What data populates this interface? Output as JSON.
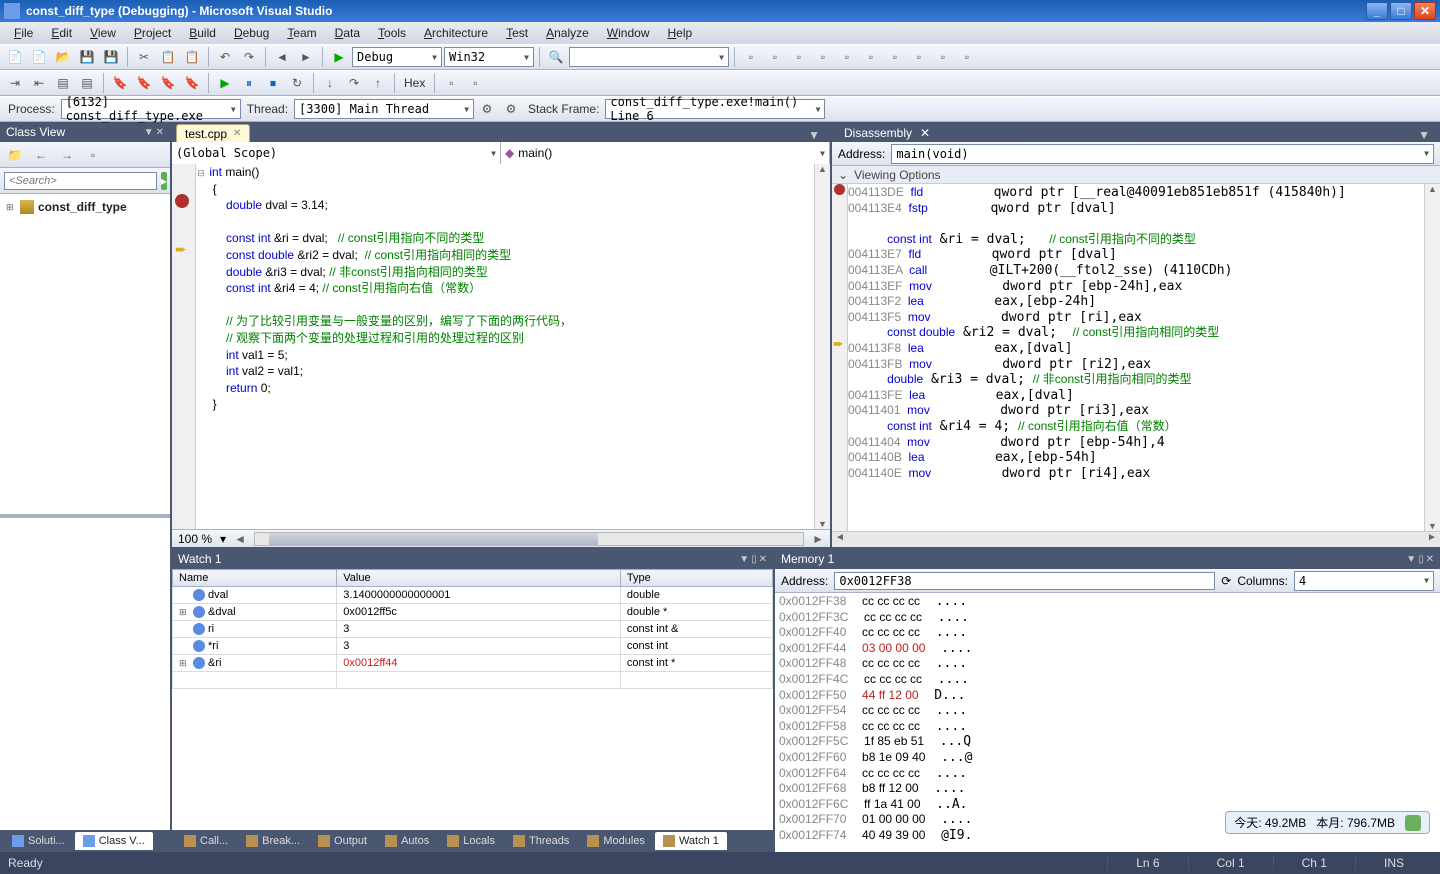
{
  "title": "const_diff_type (Debugging) - Microsoft Visual Studio",
  "menu": [
    "File",
    "Edit",
    "View",
    "Project",
    "Build",
    "Debug",
    "Team",
    "Data",
    "Tools",
    "Architecture",
    "Test",
    "Analyze",
    "Window",
    "Help"
  ],
  "toolbar2": {
    "config": "Debug",
    "platform": "Win32",
    "hex": "Hex"
  },
  "procbar": {
    "process_lbl": "Process:",
    "process": "[6132] const_diff_type.exe",
    "thread_lbl": "Thread:",
    "thread": "[3300] Main Thread",
    "frame_lbl": "Stack Frame:",
    "frame": "const_diff_type.exe!main()  Line 6"
  },
  "classview": {
    "title": "Class View",
    "search": "<Search>",
    "project": "const_diff_type"
  },
  "editor": {
    "tab": "test.cpp",
    "scope_left": "(Global Scope)",
    "scope_right": "main()",
    "zoom": "100 %",
    "code": [
      {
        "outline": "⊟",
        "t": [
          {
            "k": "kw",
            "v": "int"
          },
          {
            "v": " main()"
          }
        ]
      },
      {
        "t": [
          {
            "v": " {"
          }
        ]
      },
      {
        "t": [
          {
            "v": "     "
          },
          {
            "k": "kw",
            "v": "double"
          },
          {
            "v": " dval = 3.14;"
          }
        ]
      },
      {
        "t": [
          {
            "v": ""
          }
        ]
      },
      {
        "t": [
          {
            "v": "     "
          },
          {
            "k": "kw",
            "v": "const int"
          },
          {
            "v": " &ri = dval;   "
          },
          {
            "k": "com",
            "v": "// const引用指向不同的类型"
          }
        ]
      },
      {
        "t": [
          {
            "v": "     "
          },
          {
            "k": "kw",
            "v": "const double"
          },
          {
            "v": " &ri2 = dval;  "
          },
          {
            "k": "com",
            "v": "// const引用指向相同的类型"
          }
        ]
      },
      {
        "t": [
          {
            "v": "     "
          },
          {
            "k": "kw",
            "v": "double"
          },
          {
            "v": " &ri3 = dval; "
          },
          {
            "k": "com",
            "v": "// 非const引用指向相同的类型"
          }
        ]
      },
      {
        "t": [
          {
            "v": "     "
          },
          {
            "k": "kw",
            "v": "const int"
          },
          {
            "v": " &ri4 = 4; "
          },
          {
            "k": "com",
            "v": "// const引用指向右值（常数）"
          }
        ]
      },
      {
        "t": [
          {
            "v": ""
          }
        ]
      },
      {
        "t": [
          {
            "v": "     "
          },
          {
            "k": "com",
            "v": "// 为了比较引用变量与一般变量的区别，编写了下面的两行代码，"
          }
        ]
      },
      {
        "t": [
          {
            "v": "     "
          },
          {
            "k": "com",
            "v": "// 观察下面两个变量的处理过程和引用的处理过程的区别"
          }
        ]
      },
      {
        "t": [
          {
            "v": "     "
          },
          {
            "k": "kw",
            "v": "int"
          },
          {
            "v": " val1 = 5;"
          }
        ]
      },
      {
        "t": [
          {
            "v": "     "
          },
          {
            "k": "kw",
            "v": "int"
          },
          {
            "v": " val2 = val1;"
          }
        ]
      },
      {
        "t": [
          {
            "v": "     "
          },
          {
            "k": "kw",
            "v": "return"
          },
          {
            "v": " 0;"
          }
        ]
      },
      {
        "t": [
          {
            "v": " }"
          }
        ]
      }
    ]
  },
  "disasm": {
    "title": "Disassembly",
    "addr_lbl": "Address:",
    "addr": "main(void)",
    "viewopts": "Viewing Options",
    "lines": [
      {
        "t": [
          {
            "k": "addr",
            "v": "004113DE  "
          },
          {
            "k": "op",
            "v": "fld"
          },
          {
            "v": "         qword ptr [__real@40091eb851eb851f (415840h)]"
          }
        ]
      },
      {
        "t": [
          {
            "k": "addr",
            "v": "004113E4  "
          },
          {
            "k": "op",
            "v": "fstp"
          },
          {
            "v": "        qword ptr [dval]"
          }
        ]
      },
      {
        "t": [
          {
            "v": ""
          }
        ]
      },
      {
        "t": [
          {
            "v": "     "
          },
          {
            "k": "kw",
            "v": "const int"
          },
          {
            "v": " &ri = dval;   "
          },
          {
            "k": "com",
            "v": "// const引用指向不同的类型"
          }
        ]
      },
      {
        "t": [
          {
            "k": "addr",
            "v": "004113E7  "
          },
          {
            "k": "op",
            "v": "fld"
          },
          {
            "v": "         qword ptr [dval]"
          }
        ]
      },
      {
        "t": [
          {
            "k": "addr",
            "v": "004113EA  "
          },
          {
            "k": "op",
            "v": "call"
          },
          {
            "v": "        @ILT+200(__ftol2_sse) (4110CDh)"
          }
        ]
      },
      {
        "t": [
          {
            "k": "addr",
            "v": "004113EF  "
          },
          {
            "k": "op",
            "v": "mov"
          },
          {
            "v": "         dword ptr [ebp-24h],eax"
          }
        ]
      },
      {
        "t": [
          {
            "k": "addr",
            "v": "004113F2  "
          },
          {
            "k": "op",
            "v": "lea"
          },
          {
            "v": "         eax,[ebp-24h]"
          }
        ]
      },
      {
        "t": [
          {
            "k": "addr",
            "v": "004113F5  "
          },
          {
            "k": "op",
            "v": "mov"
          },
          {
            "v": "         dword ptr [ri],eax"
          }
        ]
      },
      {
        "t": [
          {
            "v": "     "
          },
          {
            "k": "kw",
            "v": "const double"
          },
          {
            "v": " &ri2 = dval;  "
          },
          {
            "k": "com",
            "v": "// const引用指向相同的类型"
          }
        ]
      },
      {
        "t": [
          {
            "k": "addr",
            "v": "004113F8  "
          },
          {
            "k": "op",
            "v": "lea"
          },
          {
            "v": "         eax,[dval]"
          }
        ]
      },
      {
        "t": [
          {
            "k": "addr",
            "v": "004113FB  "
          },
          {
            "k": "op",
            "v": "mov"
          },
          {
            "v": "         dword ptr [ri2],eax"
          }
        ]
      },
      {
        "t": [
          {
            "v": "     "
          },
          {
            "k": "kw",
            "v": "double"
          },
          {
            "v": " &ri3 = dval; "
          },
          {
            "k": "com",
            "v": "// 非const引用指向相同的类型"
          }
        ]
      },
      {
        "t": [
          {
            "k": "addr",
            "v": "004113FE  "
          },
          {
            "k": "op",
            "v": "lea"
          },
          {
            "v": "         eax,[dval]"
          }
        ]
      },
      {
        "t": [
          {
            "k": "addr",
            "v": "00411401  "
          },
          {
            "k": "op",
            "v": "mov"
          },
          {
            "v": "         dword ptr [ri3],eax"
          }
        ]
      },
      {
        "t": [
          {
            "v": "     "
          },
          {
            "k": "kw",
            "v": "const int"
          },
          {
            "v": " &ri4 = 4; "
          },
          {
            "k": "com",
            "v": "// const引用指向右值（常数）"
          }
        ]
      },
      {
        "t": [
          {
            "k": "addr",
            "v": "00411404  "
          },
          {
            "k": "op",
            "v": "mov"
          },
          {
            "v": "         dword ptr [ebp-54h],4"
          }
        ]
      },
      {
        "t": [
          {
            "k": "addr",
            "v": "0041140B  "
          },
          {
            "k": "op",
            "v": "lea"
          },
          {
            "v": "         eax,[ebp-54h]"
          }
        ]
      },
      {
        "t": [
          {
            "k": "addr",
            "v": "0041140E  "
          },
          {
            "k": "op",
            "v": "mov"
          },
          {
            "v": "         dword ptr [ri4],eax"
          }
        ]
      }
    ]
  },
  "watch": {
    "title": "Watch 1",
    "cols": [
      "Name",
      "Value",
      "Type"
    ],
    "rows": [
      {
        "exp": "",
        "name": "dval",
        "value": "3.1400000000000001",
        "type": "double"
      },
      {
        "exp": "⊞",
        "name": "&dval",
        "value": "0x0012ff5c",
        "type": "double *"
      },
      {
        "exp": "",
        "name": "ri",
        "value": "3",
        "type": "const int &"
      },
      {
        "exp": "",
        "name": "*ri",
        "value": "3",
        "type": "const int"
      },
      {
        "exp": "⊞",
        "name": "&ri",
        "value": "0x0012ff44",
        "type": "const int *",
        "red": true
      }
    ]
  },
  "bottomtabs": [
    "Call...",
    "Break...",
    "Output",
    "Autos",
    "Locals",
    "Threads",
    "Modules",
    "Watch 1"
  ],
  "lefttabs": [
    "Soluti...",
    "Class V..."
  ],
  "memory": {
    "title": "Memory 1",
    "addr_lbl": "Address:",
    "addr": "0x0012FF38",
    "cols_lbl": "Columns:",
    "cols": "4",
    "lines": [
      {
        "a": "0x0012FF38",
        "b": "cc cc cc cc",
        "c": "...."
      },
      {
        "a": "0x0012FF3C",
        "b": "cc cc cc cc",
        "c": "...."
      },
      {
        "a": "0x0012FF40",
        "b": "cc cc cc cc",
        "c": "...."
      },
      {
        "a": "0x0012FF44",
        "b": "03 00 00 00",
        "c": "....",
        "hi": true
      },
      {
        "a": "0x0012FF48",
        "b": "cc cc cc cc",
        "c": "...."
      },
      {
        "a": "0x0012FF4C",
        "b": "cc cc cc cc",
        "c": "...."
      },
      {
        "a": "0x0012FF50",
        "b": "44 ff 12 00",
        "c": "D...",
        "hi": true
      },
      {
        "a": "0x0012FF54",
        "b": "cc cc cc cc",
        "c": "...."
      },
      {
        "a": "0x0012FF58",
        "b": "cc cc cc cc",
        "c": "...."
      },
      {
        "a": "0x0012FF5C",
        "b": "1f 85 eb 51",
        "c": "...Q"
      },
      {
        "a": "0x0012FF60",
        "b": "b8 1e 09 40",
        "c": "...@"
      },
      {
        "a": "0x0012FF64",
        "b": "cc cc cc cc",
        "c": "...."
      },
      {
        "a": "0x0012FF68",
        "b": "b8 ff 12 00",
        "c": "...."
      },
      {
        "a": "0x0012FF6C",
        "b": "ff 1a 41 00",
        "c": "..A."
      },
      {
        "a": "0x0012FF70",
        "b": "01 00 00 00",
        "c": "...."
      },
      {
        "a": "0x0012FF74",
        "b": "40 49 39 00",
        "c": "@I9."
      }
    ]
  },
  "memnote": {
    "today": "今天: 49.2MB",
    "month": "本月: 796.7MB"
  },
  "status": {
    "ready": "Ready",
    "ln": "Ln 6",
    "col": "Col 1",
    "ch": "Ch 1",
    "ins": "INS"
  }
}
